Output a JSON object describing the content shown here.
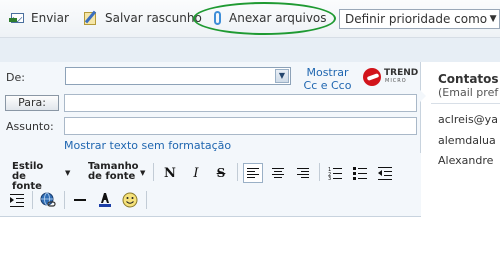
{
  "toolbar": {
    "send_label": "Enviar",
    "save_draft_label": "Salvar rascunho",
    "attach_label": "Anexar arquivos",
    "priority_value": "Definir prioridade como"
  },
  "compose": {
    "from_label": "De:",
    "show_cc_label": "Mostrar Cc e Cco",
    "trend_name": "TREND",
    "trend_sub": "MICRO",
    "to_button": "Para:",
    "subject_label": "Assunto:",
    "plain_text_link": "Mostrar texto sem formatação"
  },
  "formatting": {
    "font_style_label": "Estilo de fonte",
    "font_size_label": "Tamanho de fonte",
    "bold": "N",
    "italic": "I",
    "strike": "S"
  },
  "contacts": {
    "title": "Contatos",
    "subtitle": "(Email pref",
    "items": [
      "aclreis@ya",
      "alemdalua",
      "Alexandre"
    ]
  },
  "colors": {
    "accent_link": "#1f66b0",
    "highlight_ring": "#1f9a32",
    "brand_red": "#d2141b"
  }
}
